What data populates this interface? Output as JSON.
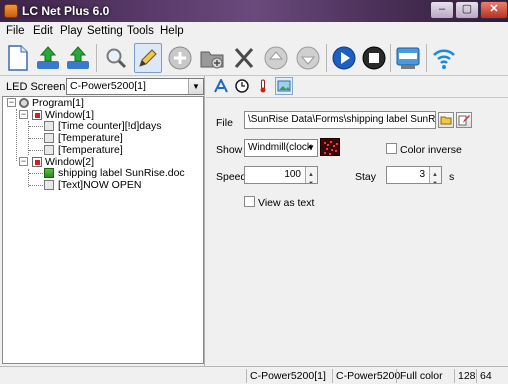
{
  "window": {
    "title": "LC Net Plus 6.0"
  },
  "menu": [
    "File",
    "Edit",
    "Play",
    "Setting",
    "Tools",
    "Help"
  ],
  "toolbar": {
    "buttons": [
      "new-file-icon",
      "upload-icon",
      "download-icon",
      "preview-icon",
      "edit-icon",
      "add-icon",
      "add-folder-icon",
      "cut-icon",
      "move-up-icon",
      "move-down-icon",
      "play-icon",
      "stop-icon",
      "instant-message-icon",
      "wireless-icon"
    ]
  },
  "led_screen": {
    "label": "LED Screen",
    "selected": "C-Power5200[1]"
  },
  "tree": {
    "program": "Program[1]",
    "window1": "Window[1]",
    "w1_items": [
      "[Time counter][!d]days",
      "[Temperature]",
      "[Temperature]"
    ],
    "window2": "Window[2]",
    "w2_items": [
      "shipping label SunRise.doc",
      "[Text]NOW OPEN"
    ]
  },
  "props": {
    "file_label": "File",
    "file_value": "\\SunRise Data\\Forms\\shipping label SunRise.doc",
    "show_label": "Show",
    "show_value": "Windmill(clock",
    "color_inverse_label": "Color inverse",
    "speed_label": "Speed",
    "speed_value": "100",
    "stay_label": "Stay",
    "stay_value": "3",
    "stay_unit": "s",
    "view_as_text_label": "View as text"
  },
  "status": {
    "screen": "C-Power5200[1]",
    "controller": "C-Power5200",
    "color_mode": "Full color",
    "width": "128",
    "height": "64"
  },
  "colors": {
    "title_bg": "#4a3058",
    "tree_bg": "#ffffff",
    "preview_red": "#ff3030"
  }
}
